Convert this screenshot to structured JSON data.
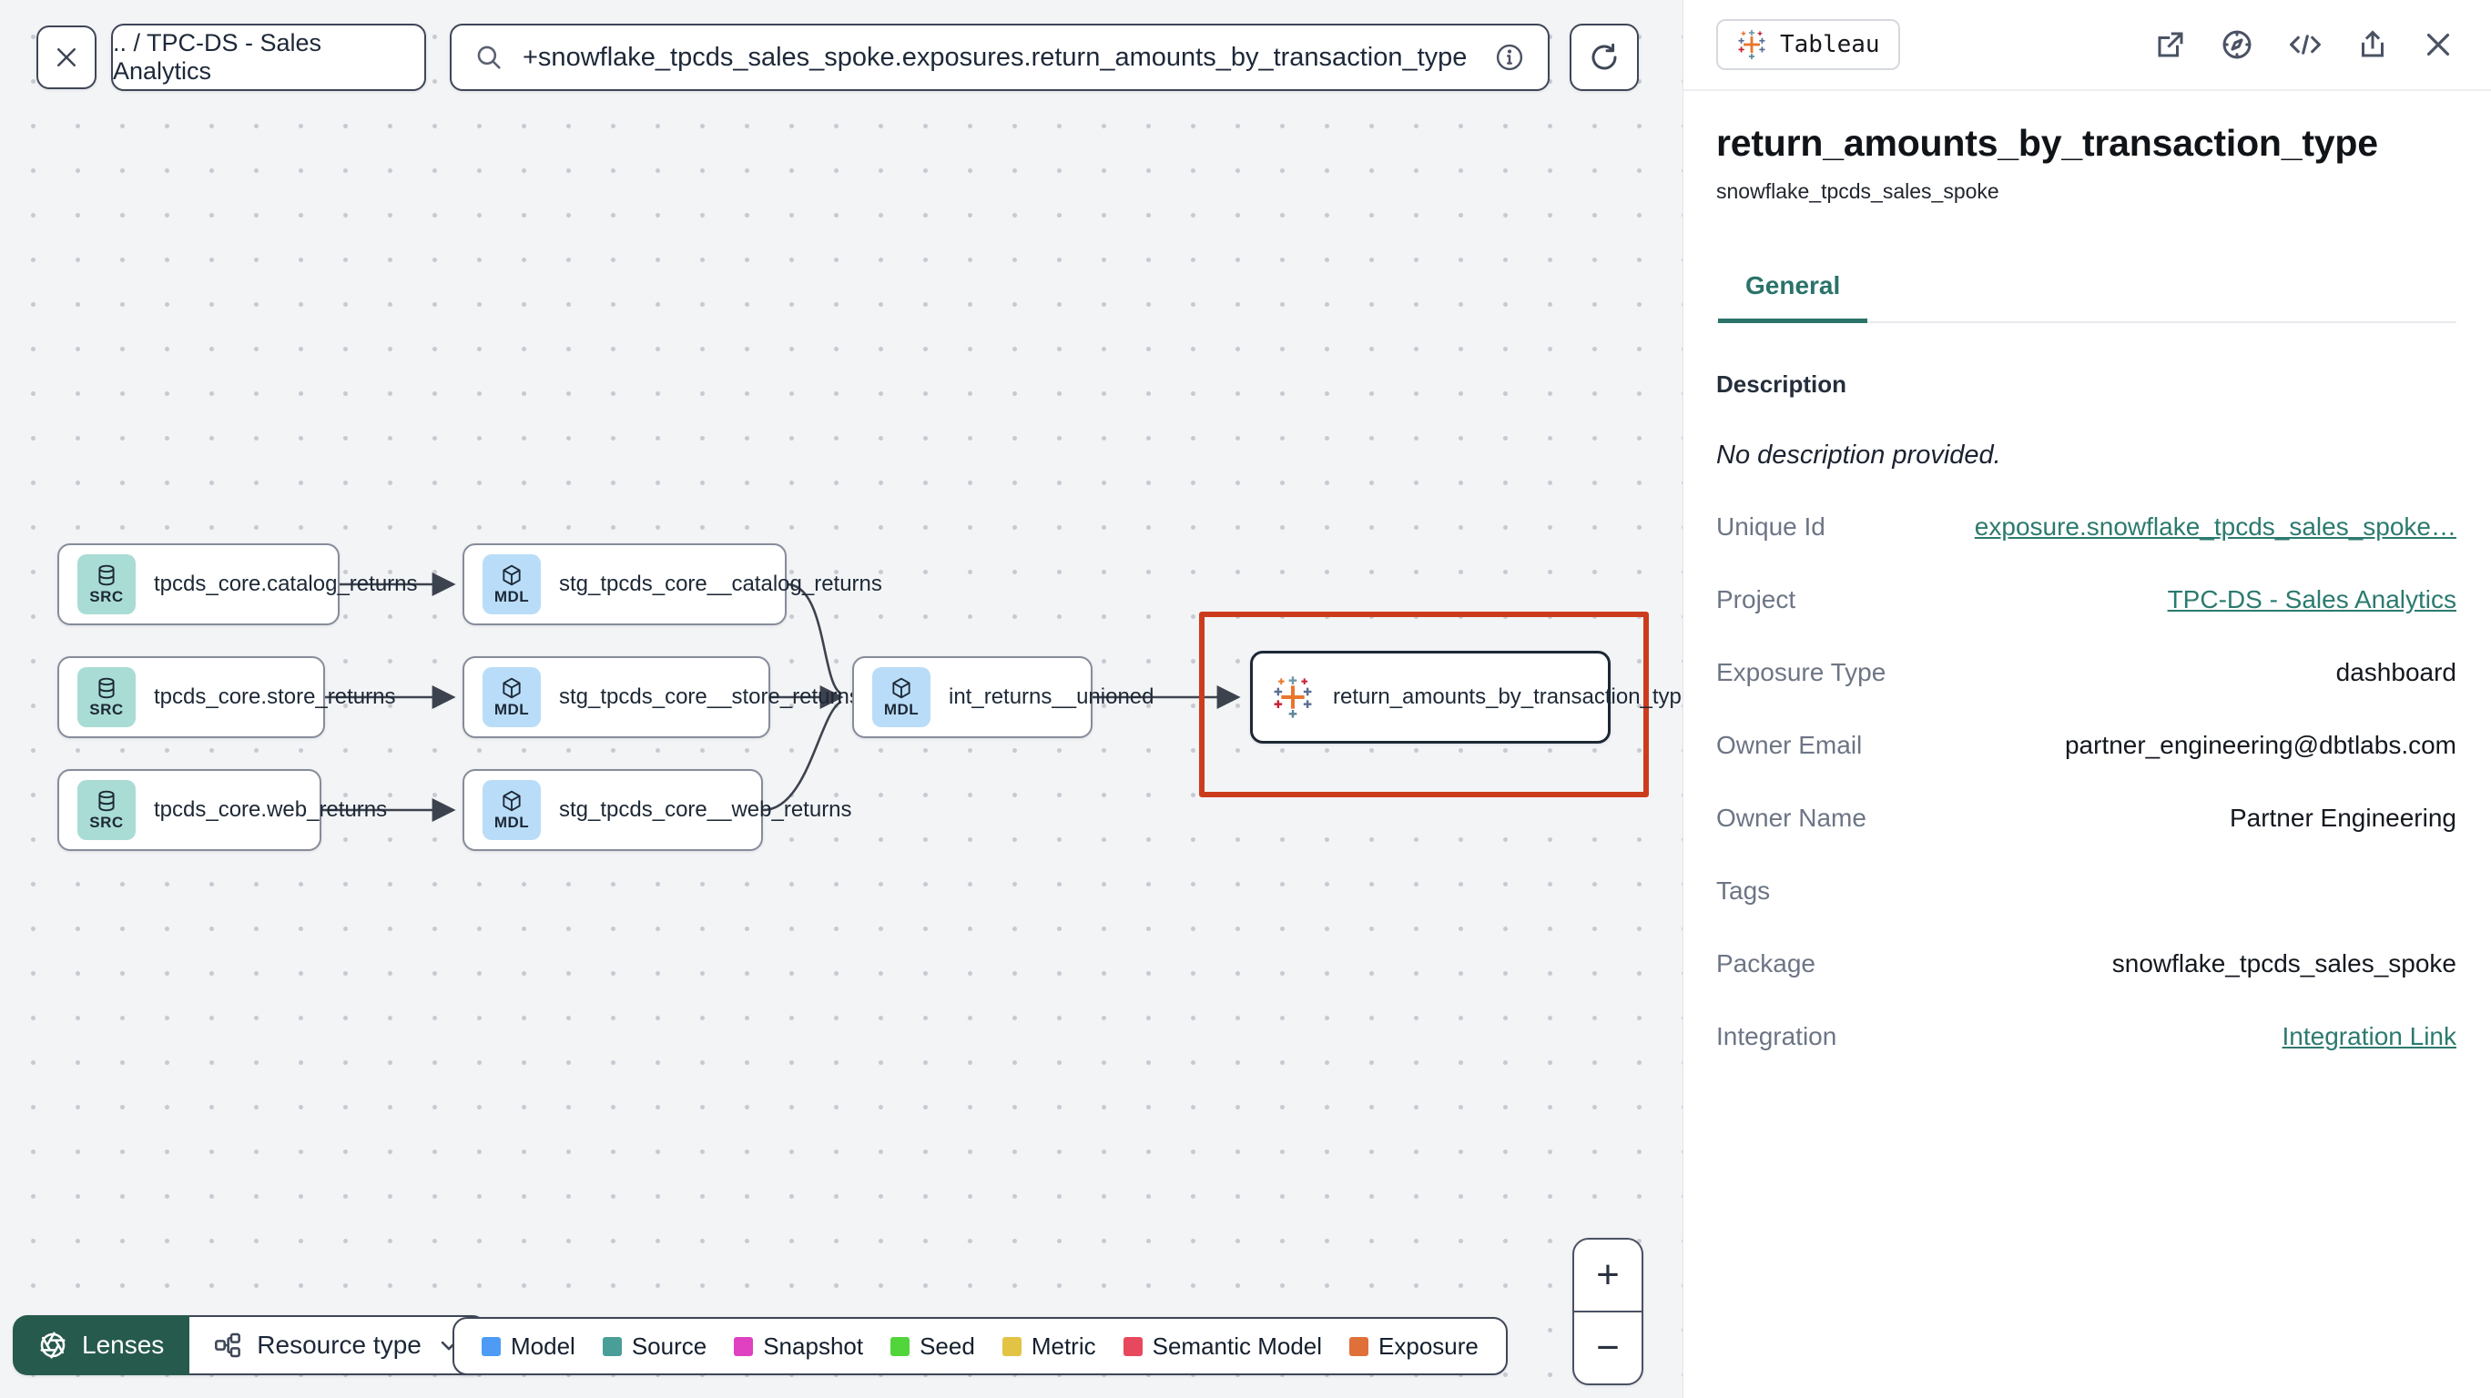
{
  "topbar": {
    "breadcrumb": ".. / TPC-DS - Sales Analytics",
    "search_value": "+snowflake_tpcds_sales_spoke.exposures.return_amounts_by_transaction_type"
  },
  "graph": {
    "nodes": [
      {
        "id": "src_catalog",
        "kind": "source",
        "badge": "SRC",
        "label": "tpcds_core.catalog_returns"
      },
      {
        "id": "src_store",
        "kind": "source",
        "badge": "SRC",
        "label": "tpcds_core.store_returns"
      },
      {
        "id": "src_web",
        "kind": "source",
        "badge": "SRC",
        "label": "tpcds_core.web_returns"
      },
      {
        "id": "stg_catalog",
        "kind": "model",
        "badge": "MDL",
        "label": "stg_tpcds_core__catalog_returns"
      },
      {
        "id": "stg_store",
        "kind": "model",
        "badge": "MDL",
        "label": "stg_tpcds_core__store_returns"
      },
      {
        "id": "stg_web",
        "kind": "model",
        "badge": "MDL",
        "label": "stg_tpcds_core__web_returns"
      },
      {
        "id": "int_unioned",
        "kind": "model",
        "badge": "MDL",
        "label": "int_returns__unioned"
      },
      {
        "id": "exposure",
        "kind": "exposure",
        "badge": "",
        "label": "return_amounts_by_transaction_type",
        "selected": true
      }
    ],
    "legend": [
      {
        "label": "Model",
        "color": "#4d9bf5"
      },
      {
        "label": "Source",
        "color": "#4a9e98"
      },
      {
        "label": "Snapshot",
        "color": "#df41c0"
      },
      {
        "label": "Seed",
        "color": "#52d53a"
      },
      {
        "label": "Metric",
        "color": "#e3c344"
      },
      {
        "label": "Semantic Model",
        "color": "#e8485e"
      },
      {
        "label": "Exposure",
        "color": "#e0703a"
      }
    ],
    "lenses_label": "Lenses",
    "resource_type_label": "Resource type",
    "zoom_in": "+",
    "zoom_out": "−"
  },
  "panel": {
    "integration_badge": "Tableau",
    "title": "return_amounts_by_transaction_type",
    "subtitle": "snowflake_tpcds_sales_spoke",
    "tabs": [
      {
        "label": "General",
        "active": true
      }
    ],
    "description_heading": "Description",
    "description_empty": "No description provided.",
    "fields": [
      {
        "label": "Unique Id",
        "value": "exposure.snowflake_tpcds_sales_spoke…",
        "type": "link"
      },
      {
        "label": "Project",
        "value": "TPC-DS - Sales Analytics",
        "type": "link"
      },
      {
        "label": "Exposure Type",
        "value": "dashboard",
        "type": "text"
      },
      {
        "label": "Owner Email",
        "value": "partner_engineering@dbtlabs.com",
        "type": "text"
      },
      {
        "label": "Owner Name",
        "value": "Partner Engineering",
        "type": "text"
      },
      {
        "label": "Tags",
        "value": "",
        "type": "empty"
      },
      {
        "label": "Package",
        "value": "snowflake_tpcds_sales_spoke",
        "type": "text"
      },
      {
        "label": "Integration",
        "value": "Integration Link",
        "type": "link"
      }
    ]
  },
  "colors": {
    "accent_teal": "#2b7369",
    "selection_red": "#cc3c1c",
    "source_badge": "#a9dcd4",
    "model_badge": "#b9ddf8",
    "lenses_green": "#265a4c"
  }
}
